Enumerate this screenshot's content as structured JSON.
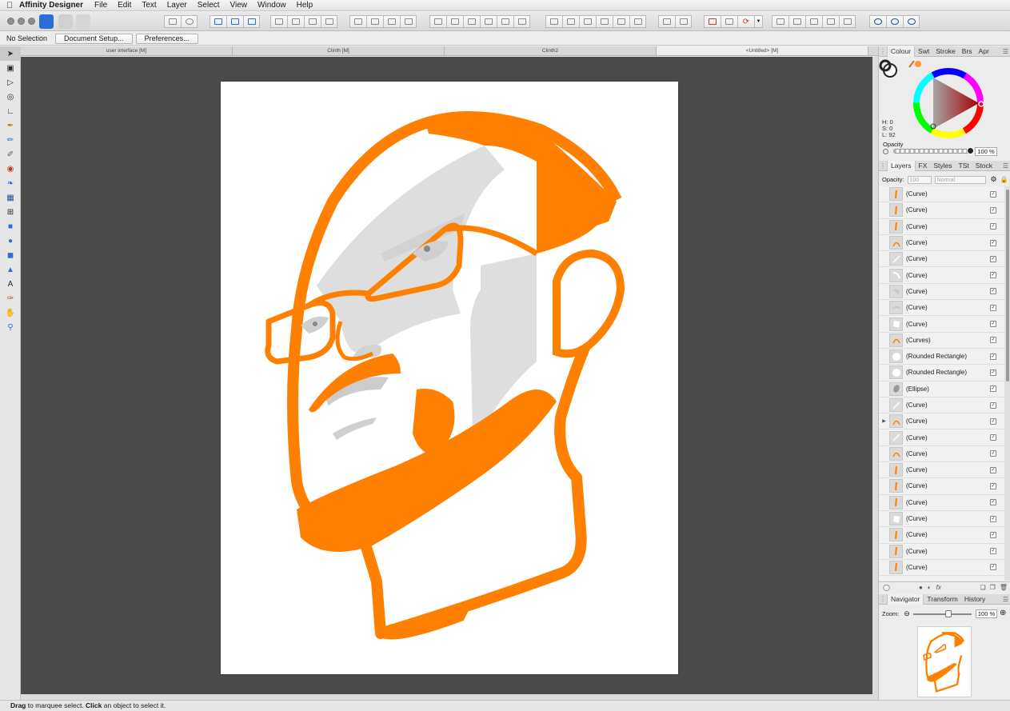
{
  "menubar": {
    "app_name": "Affinity Designer",
    "items": [
      "File",
      "Edit",
      "Text",
      "Layer",
      "Select",
      "View",
      "Window",
      "Help"
    ]
  },
  "context": {
    "selection": "No Selection",
    "document_setup": "Document Setup...",
    "preferences": "Preferences..."
  },
  "doc_tabs": [
    "user interface [M]",
    "Clinth [M]",
    "Clinth2",
    "<Untitled> [M]"
  ],
  "colour_panel": {
    "tabs": [
      "Colour",
      "Swt",
      "Stroke",
      "Brs",
      "Apr"
    ],
    "h": "H: 0",
    "s": "S: 0",
    "l": "L: 92",
    "opacity_label": "Opacity",
    "opacity_value": "100 %"
  },
  "layers_panel": {
    "tabs": [
      "Layers",
      "FX",
      "Styles",
      "TSt",
      "Stock"
    ],
    "opacity_label": "Opacity:",
    "opacity_value": "100",
    "blend_mode": "Normal",
    "layers": [
      {
        "name": "(Curve)",
        "thumb": "orange-stroke"
      },
      {
        "name": "(Curve)",
        "thumb": "orange-stroke"
      },
      {
        "name": "(Curve)",
        "thumb": "orange-stroke"
      },
      {
        "name": "(Curve)",
        "thumb": "orange-arc"
      },
      {
        "name": "(Curve)",
        "thumb": "white-line"
      },
      {
        "name": "(Curve)",
        "thumb": "white-arc"
      },
      {
        "name": "(Curve)",
        "thumb": "grey-shape"
      },
      {
        "name": "(Curve)",
        "thumb": "grey-brow"
      },
      {
        "name": "(Curve)",
        "thumb": "white-shape"
      },
      {
        "name": "(Curves)",
        "thumb": "orange-arc"
      },
      {
        "name": "(Rounded Rectangle)",
        "thumb": "white-circle"
      },
      {
        "name": "(Rounded Rectangle)",
        "thumb": "white-circle"
      },
      {
        "name": "(Ellipse)",
        "thumb": "grey-ellipse"
      },
      {
        "name": "(Curve)",
        "thumb": "white-line"
      },
      {
        "name": "(Curve)",
        "thumb": "orange-arc",
        "expandable": true
      },
      {
        "name": "(Curve)",
        "thumb": "white-line"
      },
      {
        "name": "(Curve)",
        "thumb": "orange-arc"
      },
      {
        "name": "(Curve)",
        "thumb": "orange-stroke"
      },
      {
        "name": "(Curve)",
        "thumb": "orange-stroke"
      },
      {
        "name": "(Curve)",
        "thumb": "orange-stroke"
      },
      {
        "name": "(Curve)",
        "thumb": "white-shape"
      },
      {
        "name": "(Curve)",
        "thumb": "orange-stroke"
      },
      {
        "name": "(Curve)",
        "thumb": "orange-stroke"
      },
      {
        "name": "(Curve)",
        "thumb": "orange-stroke"
      }
    ]
  },
  "navigator_panel": {
    "tabs": [
      "Navigator",
      "Transform",
      "History"
    ],
    "zoom_label": "Zoom:",
    "zoom_value": "100 %"
  },
  "status": {
    "drag": "Drag",
    "text1": " to marquee select. ",
    "click": "Click",
    "text2": " an object to select it."
  },
  "colors": {
    "accent_orange": "#ff8000",
    "shade_grey": "#dedede",
    "canvas_bg": "#4a4a4a"
  }
}
